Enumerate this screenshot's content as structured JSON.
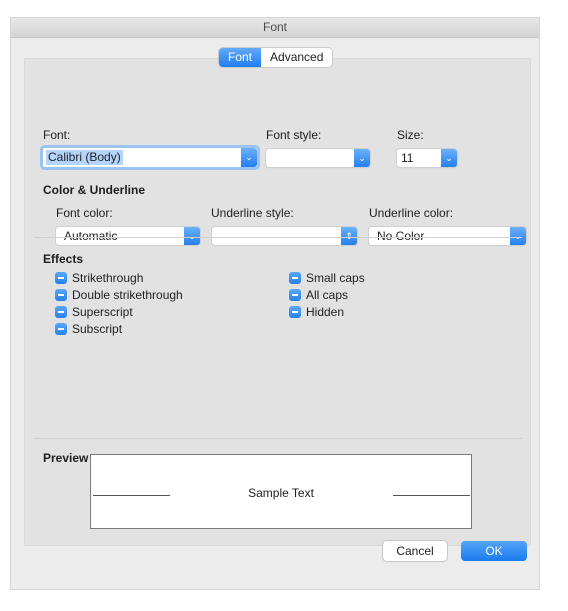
{
  "window": {
    "title": "Font"
  },
  "tabs": [
    {
      "label": "Font",
      "active": true
    },
    {
      "label": "Advanced",
      "active": false
    }
  ],
  "font_row": {
    "font_label": "Font:",
    "font_value": "Calibri (Body)",
    "style_label": "Font style:",
    "style_value": "",
    "size_label": "Size:",
    "size_value": "11"
  },
  "color_underline": {
    "heading": "Color & Underline",
    "font_color_label": "Font color:",
    "font_color_value": "Automatic",
    "underline_style_label": "Underline style:",
    "underline_style_value": "",
    "underline_color_label": "Underline color:",
    "underline_color_value": "No Color"
  },
  "effects": {
    "heading": "Effects",
    "left": [
      {
        "label": "Strikethrough",
        "state": "mixed"
      },
      {
        "label": "Double strikethrough",
        "state": "mixed"
      },
      {
        "label": "Superscript",
        "state": "mixed"
      },
      {
        "label": "Subscript",
        "state": "mixed"
      }
    ],
    "right": [
      {
        "label": "Small caps",
        "state": "mixed"
      },
      {
        "label": "All caps",
        "state": "mixed"
      },
      {
        "label": "Hidden",
        "state": "mixed"
      }
    ]
  },
  "preview": {
    "heading": "Preview",
    "sample_text": "Sample Text"
  },
  "buttons": {
    "cancel": "Cancel",
    "ok": "OK"
  },
  "icons": {
    "popup_arrow": "chevron-down-icon",
    "stepper_arrow": "up-down-chevron-icon",
    "checkbox_mixed": "minus-checkbox-icon"
  },
  "colors": {
    "accent": "#1f7ff0",
    "panel": "#e2e2e2",
    "window": "#ececec"
  }
}
